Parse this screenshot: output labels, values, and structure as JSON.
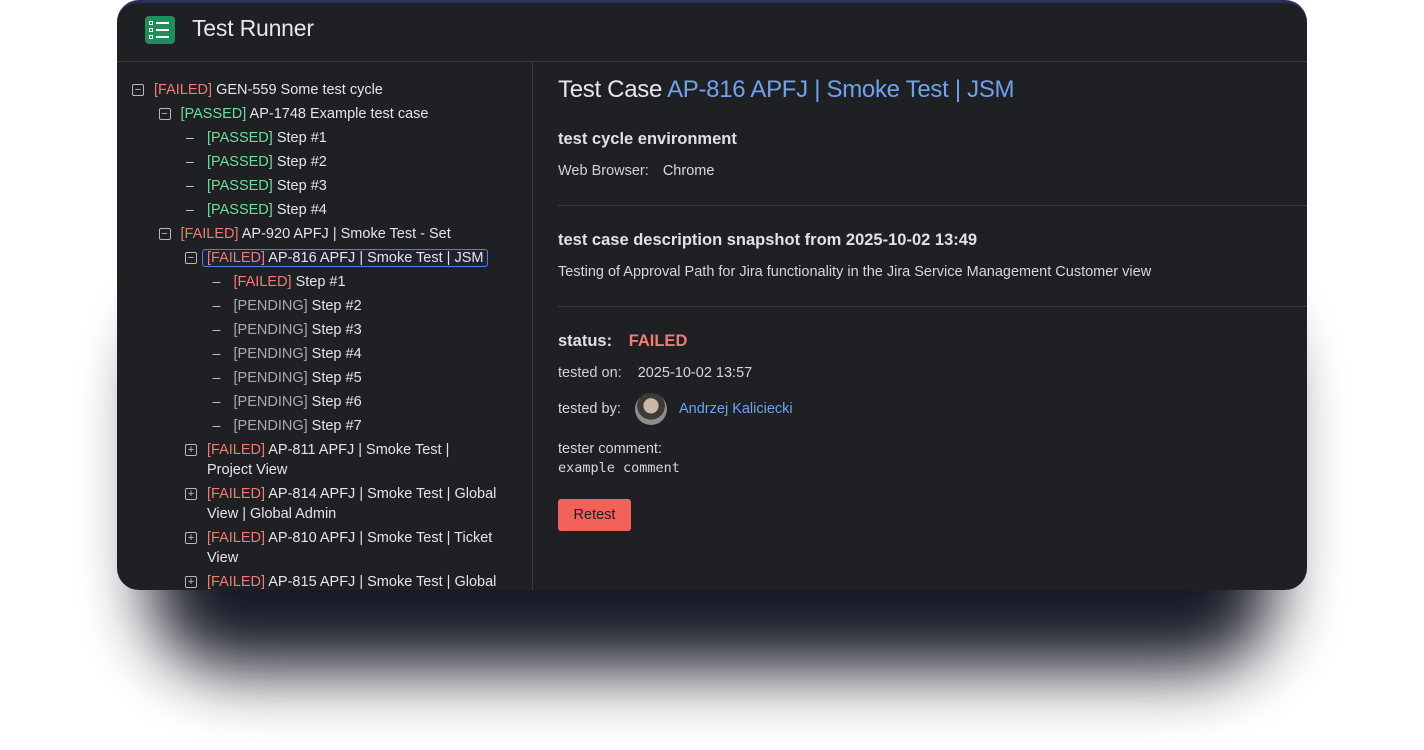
{
  "app": {
    "title": "Test Runner"
  },
  "tree": [
    {
      "toggle": "minus",
      "status": "[FAILED]",
      "status_type": "failed",
      "label": "GEN-559 Some test cycle"
    },
    {
      "toggle": "minus",
      "status": "[PASSED]",
      "status_type": "passed",
      "label": "AP-1748 Example test case"
    },
    {
      "toggle": "dash",
      "status": "[PASSED]",
      "status_type": "passed",
      "label": "Step #1"
    },
    {
      "toggle": "dash",
      "status": "[PASSED]",
      "status_type": "passed",
      "label": "Step #2"
    },
    {
      "toggle": "dash",
      "status": "[PASSED]",
      "status_type": "passed",
      "label": "Step #3"
    },
    {
      "toggle": "dash",
      "status": "[PASSED]",
      "status_type": "passed",
      "label": "Step #4"
    },
    {
      "toggle": "minus",
      "status": "[FAILED]",
      "status_type": "failed",
      "label": "AP-920 APFJ | Smoke Test - Set"
    },
    {
      "toggle": "minus",
      "status": "[FAILED]",
      "status_type": "failed",
      "label": "AP-816 APFJ | Smoke Test | JSM",
      "selected": true
    },
    {
      "toggle": "dash",
      "status": "[FAILED]",
      "status_type": "failed",
      "label": "Step #1"
    },
    {
      "toggle": "dash",
      "status": "[PENDING]",
      "status_type": "pending",
      "label": "Step #2"
    },
    {
      "toggle": "dash",
      "status": "[PENDING]",
      "status_type": "pending",
      "label": "Step #3"
    },
    {
      "toggle": "dash",
      "status": "[PENDING]",
      "status_type": "pending",
      "label": "Step #4"
    },
    {
      "toggle": "dash",
      "status": "[PENDING]",
      "status_type": "pending",
      "label": "Step #5"
    },
    {
      "toggle": "dash",
      "status": "[PENDING]",
      "status_type": "pending",
      "label": "Step #6"
    },
    {
      "toggle": "dash",
      "status": "[PENDING]",
      "status_type": "pending",
      "label": "Step #7"
    },
    {
      "toggle": "plus",
      "status": "[FAILED]",
      "status_type": "failed",
      "label": "AP-811 APFJ | Smoke Test | Project View"
    },
    {
      "toggle": "plus",
      "status": "[FAILED]",
      "status_type": "failed",
      "label": "AP-814 APFJ | Smoke Test | Global View | Global Admin"
    },
    {
      "toggle": "plus",
      "status": "[FAILED]",
      "status_type": "failed",
      "label": "AP-810 APFJ | Smoke Test | Ticket View"
    },
    {
      "toggle": "plus",
      "status": "[FAILED]",
      "status_type": "failed",
      "label": "AP-815 APFJ | Smoke Test | Global"
    }
  ],
  "detail": {
    "title_prefix": "Test Case",
    "title_key": "AP-816 APFJ | Smoke Test | JSM",
    "env_heading": "test cycle environment",
    "env_label": "Web Browser:",
    "env_value": "Chrome",
    "desc_heading": "test case description snapshot from 2025-10-02 13:49",
    "desc_text": "Testing of Approval Path for Jira functionality in the Jira Service Management Customer view",
    "status_label": "status:",
    "status_value": "FAILED",
    "tested_on_label": "tested on:",
    "tested_on_value": "2025-10-02 13:57",
    "tested_by_label": "tested by:",
    "tested_by_value": "Andrzej Kaliciecki",
    "comment_label": "tester comment:",
    "comment_value": "example comment",
    "retest_label": "Retest"
  },
  "colors": {
    "failed": "#f07c74",
    "passed": "#6fdca0",
    "pending": "#a9aaae",
    "link": "#6fa2ee",
    "retest": "#f2625a"
  }
}
